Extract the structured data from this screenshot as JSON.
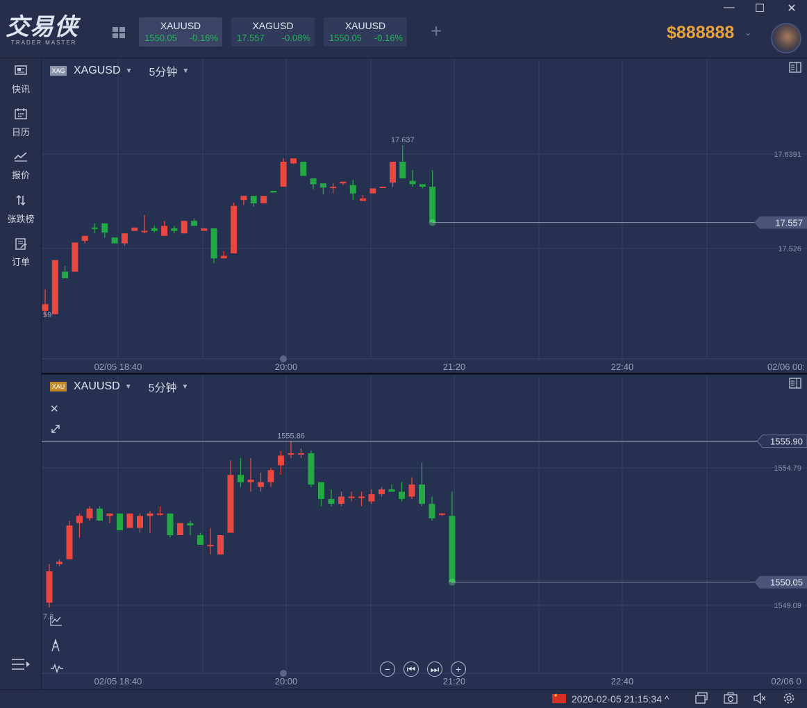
{
  "app": {
    "logo_text": "交易侠",
    "logo_sub": "TRADER MASTER",
    "balance": "$888888",
    "window_controls": [
      "—",
      "☐",
      "✕"
    ]
  },
  "tabs": [
    {
      "symbol": "XAUUSD",
      "price": "1550.05",
      "change": "-0.16%"
    },
    {
      "symbol": "XAGUSD",
      "price": "17.557",
      "change": "-0.08%"
    },
    {
      "symbol": "XAUUSD",
      "price": "1550.05",
      "change": "-0.16%"
    }
  ],
  "sidebar": {
    "items": [
      {
        "label": "快讯",
        "icon": "news-icon"
      },
      {
        "label": "日历",
        "icon": "calendar-icon"
      },
      {
        "label": "报价",
        "icon": "quote-icon"
      },
      {
        "label": "张跌榜",
        "icon": "ranking-icon"
      },
      {
        "label": "订单",
        "icon": "order-icon"
      }
    ]
  },
  "colors": {
    "up": "#e8483f",
    "down": "#23a845",
    "grid": "#34406a",
    "axis_text": "#8a92aa"
  },
  "chart1": {
    "symbol": "XAGUSD",
    "badge": "XAG",
    "timeframe": "5分钟",
    "x_ticks": [
      "02/05 18:40",
      "20:00",
      "21:20",
      "22:40",
      "02/06 00:"
    ],
    "y_ticks": [
      "17.6391",
      "17.526"
    ],
    "last_price": "17.557",
    "high_label": "17.637",
    "low_label": "59"
  },
  "chart2": {
    "symbol": "XAUUSD",
    "badge": "XAU",
    "timeframe": "5分钟",
    "x_ticks": [
      "02/05 18:40",
      "20:00",
      "21:20",
      "22:40",
      "02/06 0"
    ],
    "y_ticks": [
      "1554.79",
      "1549.09"
    ],
    "crosshair_price": "1555.90",
    "last_price": "1550.05",
    "high_label": "1555.86",
    "low_label": "7.3"
  },
  "chart_data": [
    {
      "type": "candlestick",
      "title": "XAGUSD 5分钟",
      "ylim": [
        17.4,
        17.72
      ],
      "y_ticks": [
        17.6391,
        17.526
      ],
      "x_ticks": [
        "02/05 18:40",
        "20:00",
        "21:20",
        "22:40",
        "02/06 00:"
      ],
      "candles": [
        [
          17.451,
          17.477,
          17.444,
          17.459
        ],
        [
          17.447,
          17.512,
          17.447,
          17.512
        ],
        [
          17.498,
          17.505,
          17.49,
          17.49
        ],
        [
          17.498,
          17.533,
          17.498,
          17.533
        ],
        [
          17.535,
          17.541,
          17.532,
          17.541
        ],
        [
          17.551,
          17.556,
          17.544,
          17.55
        ],
        [
          17.556,
          17.556,
          17.539,
          17.545
        ],
        [
          17.539,
          17.539,
          17.532,
          17.532
        ],
        [
          17.532,
          17.544,
          17.529,
          17.544
        ],
        [
          17.547,
          17.551,
          17.547,
          17.551
        ],
        [
          17.547,
          17.566,
          17.544,
          17.547
        ],
        [
          17.55,
          17.553,
          17.545,
          17.547
        ],
        [
          17.541,
          17.559,
          17.541,
          17.553
        ],
        [
          17.55,
          17.553,
          17.544,
          17.547
        ],
        [
          17.544,
          17.559,
          17.544,
          17.559
        ],
        [
          17.559,
          17.562,
          17.553,
          17.553
        ],
        [
          17.547,
          17.55,
          17.547,
          17.55
        ],
        [
          17.55,
          17.55,
          17.508,
          17.514
        ],
        [
          17.514,
          17.523,
          17.514,
          17.517
        ],
        [
          17.52,
          17.581,
          17.52,
          17.577
        ],
        [
          17.584,
          17.586,
          17.578,
          17.589
        ],
        [
          17.589,
          17.589,
          17.576,
          17.58
        ],
        [
          17.58,
          17.589,
          17.58,
          17.589
        ],
        [
          17.595,
          17.595,
          17.593,
          17.593
        ],
        [
          17.6,
          17.634,
          17.6,
          17.63
        ],
        [
          17.628,
          17.634,
          17.627,
          17.634
        ],
        [
          17.63,
          17.63,
          17.613,
          17.613
        ],
        [
          17.61,
          17.61,
          17.597,
          17.603
        ],
        [
          17.604,
          17.604,
          17.591,
          17.599
        ],
        [
          17.6,
          17.604,
          17.592,
          17.6
        ],
        [
          17.604,
          17.606,
          17.602,
          17.606
        ],
        [
          17.602,
          17.608,
          17.584,
          17.592
        ],
        [
          17.583,
          17.59,
          17.583,
          17.586
        ],
        [
          17.592,
          17.598,
          17.592,
          17.598
        ],
        [
          17.6,
          17.6,
          17.6,
          17.6
        ],
        [
          17.605,
          17.63,
          17.6,
          17.63
        ],
        [
          17.63,
          17.65,
          17.61,
          17.61
        ],
        [
          17.607,
          17.62,
          17.6,
          17.603
        ],
        [
          17.603,
          17.603,
          17.598,
          17.6
        ],
        [
          17.6,
          17.62,
          17.557,
          17.557
        ]
      ]
    },
    {
      "type": "candlestick",
      "title": "XAUUSD 5分钟",
      "ylim": [
        1546.5,
        1557.5
      ],
      "y_ticks": [
        1554.79,
        1549.09
      ],
      "x_ticks": [
        "02/05 18:40",
        "20:00",
        "21:20",
        "22:40",
        "02/06 0"
      ],
      "candles": [
        [
          1549.2,
          1550.8,
          1549.0,
          1550.5
        ],
        [
          1550.8,
          1551.0,
          1550.7,
          1550.9
        ],
        [
          1551.0,
          1552.6,
          1551.0,
          1552.4
        ],
        [
          1552.5,
          1552.9,
          1551.9,
          1552.8
        ],
        [
          1552.7,
          1553.2,
          1552.6,
          1553.1
        ],
        [
          1553.1,
          1553.2,
          1552.6,
          1552.6
        ],
        [
          1552.8,
          1552.9,
          1552.5,
          1552.9
        ],
        [
          1552.9,
          1552.9,
          1552.2,
          1552.2
        ],
        [
          1552.3,
          1552.9,
          1552.3,
          1552.9
        ],
        [
          1552.3,
          1552.9,
          1552.1,
          1552.8
        ],
        [
          1552.8,
          1553.0,
          1552.1,
          1552.9
        ],
        [
          1552.9,
          1553.2,
          1552.8,
          1552.9
        ],
        [
          1552.9,
          1552.9,
          1551.9,
          1552.0
        ],
        [
          1552.0,
          1552.5,
          1552.0,
          1552.5
        ],
        [
          1552.5,
          1552.6,
          1552.0,
          1552.4
        ],
        [
          1552.0,
          1552.1,
          1551.6,
          1551.6
        ],
        [
          1551.6,
          1552.3,
          1551.2,
          1551.6
        ],
        [
          1551.2,
          1552.0,
          1551.2,
          1552.0
        ],
        [
          1552.1,
          1555.1,
          1552.1,
          1554.5
        ],
        [
          1554.5,
          1555.2,
          1554.0,
          1554.2
        ],
        [
          1554.2,
          1555.2,
          1553.8,
          1554.3
        ],
        [
          1554.0,
          1554.6,
          1553.8,
          1554.2
        ],
        [
          1554.2,
          1554.8,
          1554.0,
          1554.7
        ],
        [
          1554.9,
          1555.5,
          1554.5,
          1555.3
        ],
        [
          1555.4,
          1555.9,
          1555.2,
          1555.4
        ],
        [
          1555.4,
          1555.6,
          1555.2,
          1555.4
        ],
        [
          1555.4,
          1555.5,
          1554.0,
          1554.1
        ],
        [
          1554.2,
          1554.2,
          1553.2,
          1553.5
        ],
        [
          1553.5,
          1553.9,
          1553.2,
          1553.3
        ],
        [
          1553.3,
          1553.8,
          1553.2,
          1553.6
        ],
        [
          1553.6,
          1553.8,
          1553.4,
          1553.6
        ],
        [
          1553.6,
          1553.8,
          1553.2,
          1553.6
        ],
        [
          1553.4,
          1553.9,
          1553.3,
          1553.7
        ],
        [
          1553.7,
          1554.0,
          1553.6,
          1553.9
        ],
        [
          1553.9,
          1554.1,
          1553.8,
          1553.8
        ],
        [
          1553.8,
          1554.2,
          1553.4,
          1553.5
        ],
        [
          1553.6,
          1554.4,
          1553.5,
          1554.1
        ],
        [
          1554.1,
          1555.0,
          1553.2,
          1553.3
        ],
        [
          1553.3,
          1553.6,
          1552.6,
          1552.7
        ],
        [
          1552.9,
          1552.9,
          1552.8,
          1552.9
        ],
        [
          1552.8,
          1553.8,
          1550.0,
          1550.05
        ]
      ]
    }
  ],
  "zoom_controls": [
    "−",
    "⏮",
    "⏭",
    "+"
  ],
  "status": {
    "datetime": "2020-02-05 21:15:34",
    "caret": "^"
  }
}
